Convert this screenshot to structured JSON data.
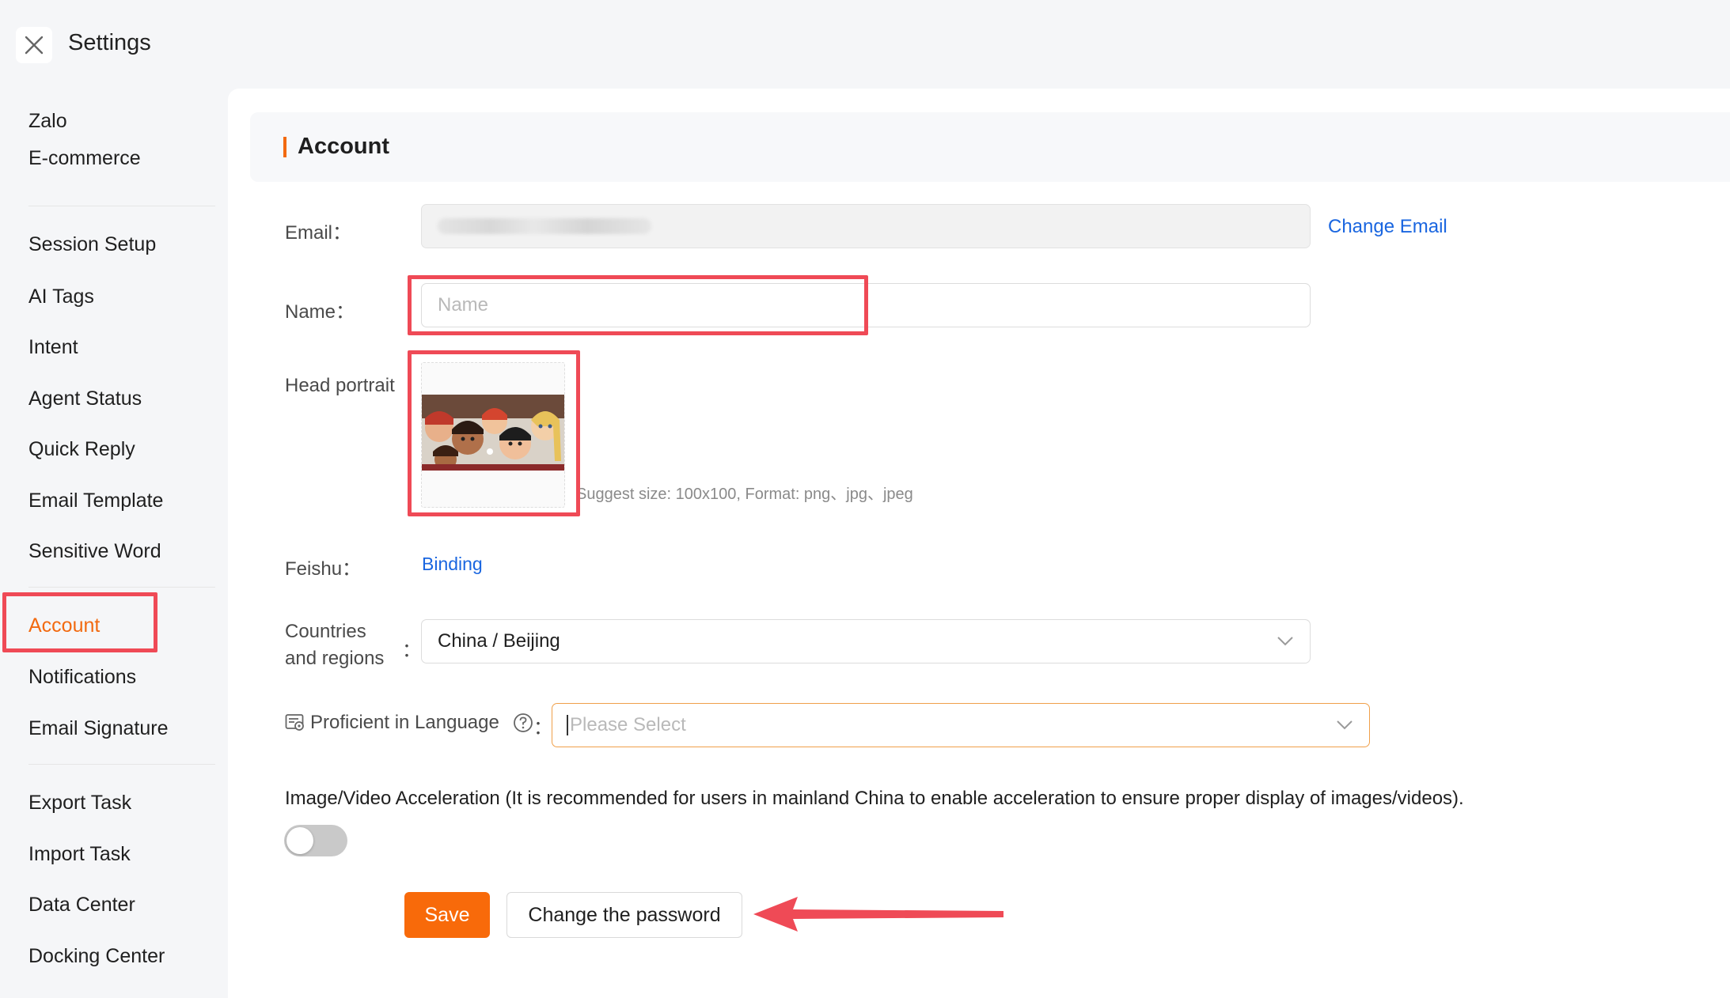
{
  "header": {
    "title": "Settings",
    "close_icon": "close-icon"
  },
  "sidebar": {
    "groups": [
      [
        "Zalo",
        "E-commerce"
      ],
      [
        "Session Setup",
        "AI Tags",
        "Intent",
        "Agent Status",
        "Quick Reply",
        "Email Template",
        "Sensitive Word"
      ],
      [
        "Account",
        "Notifications",
        "Email Signature"
      ],
      [
        "Export Task",
        "Import Task",
        "Data Center",
        "Docking Center"
      ]
    ],
    "active": "Account"
  },
  "section": {
    "title": "Account"
  },
  "form": {
    "email_label": "Email：",
    "change_email": "Change Email",
    "name_label": "Name：",
    "name_placeholder": "Name",
    "portrait_label": "Head portrait",
    "portrait_hint": "Suggest size: 100x100, Format: png、jpg、jpeg",
    "feishu_label": "Feishu：",
    "feishu_link": "Binding",
    "countries_label_1": "Countries",
    "countries_label_2": "and regions",
    "countries_colon": "：",
    "countries_value": "China / Beijing",
    "language_label": "Proficient in Language",
    "language_colon": "：",
    "language_placeholder": "Please Select",
    "acceleration_label": "Image/Video Acceleration (It is recommended for users in mainland China to enable acceleration to ensure proper display of images/videos).",
    "acceleration_enabled": false
  },
  "actions": {
    "save": "Save",
    "change_password": "Change the password"
  },
  "colors": {
    "accent": "#f26a10",
    "link": "#1a66e0",
    "highlight": "#ef4a56"
  }
}
